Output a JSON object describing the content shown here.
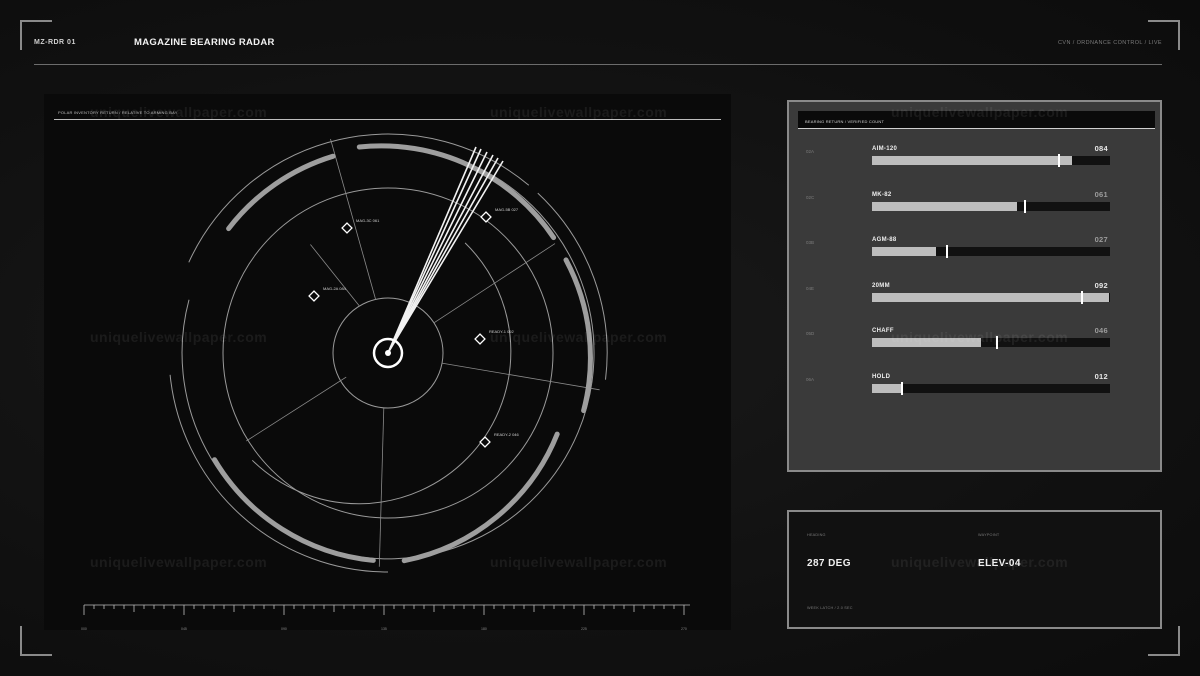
{
  "header": {
    "id": "MZ-RDR 01",
    "title": "MAGAZINE BEARING RADAR",
    "status": "CVN / ORDNANCE CONTROL / LIVE"
  },
  "radar": {
    "caption": "POLAR INVENTORY RETURN / RELATIVE TO ARMING BAY",
    "targets": [
      {
        "label": "MAG-3C 061"
      },
      {
        "label": "MAG-5B 027"
      },
      {
        "label": "MAG-2A 084"
      },
      {
        "label": "READY-1 092"
      },
      {
        "label": "READY-2 046"
      }
    ],
    "scale_ticks": [
      "000",
      "045",
      "090",
      "135",
      "180",
      "225",
      "270",
      "315"
    ]
  },
  "inventory": {
    "header": "BEARING RETURN / VERIFIED COUNT",
    "rows": [
      {
        "code": "02A",
        "name": "AIM-120",
        "count": "084",
        "fill": 0.84,
        "marker": 0.78,
        "bright": true
      },
      {
        "code": "02C",
        "name": "MK-82",
        "count": "061",
        "fill": 0.61,
        "marker": 0.64,
        "bright": false
      },
      {
        "code": "03B",
        "name": "AGM-88",
        "count": "027",
        "fill": 0.27,
        "marker": 0.31,
        "bright": false
      },
      {
        "code": "04E",
        "name": "20MM",
        "count": "092",
        "fill": 0.995,
        "marker": 0.88,
        "bright": true
      },
      {
        "code": "05D",
        "name": "CHAFF",
        "count": "046",
        "fill": 0.46,
        "marker": 0.52,
        "bright": false
      },
      {
        "code": "06A",
        "name": "HOLD",
        "count": "012",
        "fill": 0.12,
        "marker": 0.12,
        "bright": true
      }
    ]
  },
  "nav": {
    "heading_label": "HEADING",
    "heading_value": "287 DEG",
    "waypoint_label": "WAYPOINT",
    "waypoint_value": "ELEV-04",
    "footnote": "WEEK LATCH / 2.0 SEC"
  },
  "watermark": "uniquelivewallpaper.com",
  "colors": {
    "background": "#101010",
    "radar_bg": "#0a0a0a",
    "panel_bg": "#3a3a3a",
    "bar_fill": "#bdbdbd",
    "bar_track": "#111111",
    "accent": "#ffffff"
  }
}
